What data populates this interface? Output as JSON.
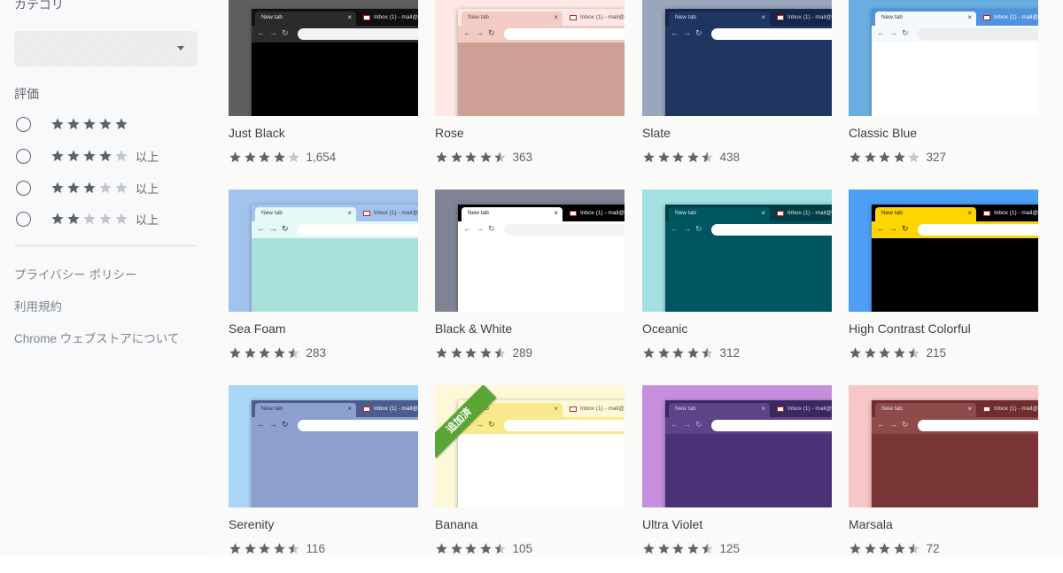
{
  "sidebar": {
    "category_heading": "カテゴリ",
    "category_select": {
      "value": ""
    },
    "rating_heading": "評価",
    "rating_options": [
      {
        "stars": 5,
        "suffix": ""
      },
      {
        "stars": 4,
        "suffix": "以上"
      },
      {
        "stars": 3,
        "suffix": "以上"
      },
      {
        "stars": 2,
        "suffix": "以上"
      }
    ],
    "links": [
      "プライバシー ポリシー",
      "利用規約",
      "Chrome ウェブストアについて"
    ]
  },
  "mock_browser": {
    "new_tab": "New tab",
    "second_tab": "Inbox (1) - mail@"
  },
  "badge_new": "追加済",
  "themes": [
    {
      "name": "Just Black",
      "rating": 4.0,
      "count": "1,654",
      "colors": {
        "bg": "#5f5f5f",
        "tabstrip": "#101010",
        "tab": "#2b2b2b",
        "tabtext": "#e8e8e8",
        "toolbar": "#2b2b2b",
        "omni": "#f1f3f4",
        "icons": "#bdbdbd",
        "ntp": "#000000",
        "tab2text": "#e0e0e0"
      }
    },
    {
      "name": "Rose",
      "rating": 4.5,
      "count": "363",
      "colors": {
        "bg": "#fde8e6",
        "tabstrip": "#fde8e6",
        "tab": "#f3cbc5",
        "tabtext": "#5a4744",
        "toolbar": "#f3cbc5",
        "omni": "#ffffff",
        "icons": "#5a4744",
        "ntp": "#cda096",
        "tab2text": "#5a4744"
      }
    },
    {
      "name": "Slate",
      "rating": 4.5,
      "count": "438",
      "colors": {
        "bg": "#9ba5bc",
        "tabstrip": "#16254a",
        "tab": "#1f3663",
        "tabtext": "#d6dbe6",
        "toolbar": "#1f3663",
        "omni": "#ffffff",
        "icons": "#c5cbd8",
        "ntp": "#1f3663",
        "tab2text": "#d6dbe6"
      }
    },
    {
      "name": "Classic Blue",
      "rating": 4.0,
      "count": "327",
      "colors": {
        "bg": "#6aaee0",
        "tabstrip": "#4f92de",
        "tab": "#f5f8fc",
        "tabtext": "#3c4043",
        "toolbar": "#f5f8fc",
        "omni": "#ebedef",
        "icons": "#5f6368",
        "ntp": "#ffffff",
        "tab2text": "#ffffff"
      }
    },
    {
      "name": "Sea Foam",
      "rating": 4.5,
      "count": "283",
      "colors": {
        "bg": "#a3c3ef",
        "tabstrip": "#a3c3ef",
        "tab": "#e4f8f5",
        "tabtext": "#3c4043",
        "toolbar": "#e4f8f5",
        "omni": "#ffffff",
        "icons": "#3c4043",
        "ntp": "#a8e1da",
        "tab2text": "#3c4043"
      }
    },
    {
      "name": "Black & White",
      "rating": 4.5,
      "count": "289",
      "colors": {
        "bg": "#7f8394",
        "tabstrip": "#000000",
        "tab": "#ffffff",
        "tabtext": "#202124",
        "toolbar": "#ffffff",
        "omni": "#f1f3f4",
        "icons": "#5f6368",
        "ntp": "#ffffff",
        "tab2text": "#ffffff"
      }
    },
    {
      "name": "Oceanic",
      "rating": 4.5,
      "count": "312",
      "colors": {
        "bg": "#a3e1e1",
        "tabstrip": "#003f46",
        "tab": "#005660",
        "tabtext": "#d3eaec",
        "toolbar": "#005660",
        "omni": "#ffffff",
        "icons": "#9ec8cc",
        "ntp": "#005660",
        "tab2text": "#d3eaec"
      }
    },
    {
      "name": "High Contrast Colorful",
      "rating": 4.5,
      "count": "215",
      "colors": {
        "bg": "#4d9ff5",
        "tabstrip": "#000000",
        "tab": "#fdd600",
        "tabtext": "#202124",
        "toolbar": "#fdd600",
        "omni": "#ffffff",
        "icons": "#202124",
        "ntp": "#000000",
        "tab2text": "#ffffff"
      }
    },
    {
      "name": "Serenity",
      "rating": 4.5,
      "count": "116",
      "colors": {
        "bg": "#a9d6f7",
        "tabstrip": "#4b5c8e",
        "tab": "#8c9fcf",
        "tabtext": "#2a3354",
        "toolbar": "#8c9fcf",
        "omni": "#ffffff",
        "icons": "#2a3354",
        "ntp": "#8c9fcf",
        "tab2text": "#ffffff"
      }
    },
    {
      "name": "Banana",
      "rating": 4.5,
      "count": "105",
      "colors": {
        "bg": "#fdf8d8",
        "tabstrip": "#fdf8d8",
        "tab": "#f8ea8a",
        "tabtext": "#5a5a30",
        "toolbar": "#f8ea8a",
        "omni": "#ffffff",
        "icons": "#5a5a30",
        "ntp": "#ffffff",
        "tab2text": "#5a5a30"
      }
    },
    {
      "name": "Ultra Violet",
      "rating": 4.5,
      "count": "125",
      "colors": {
        "bg": "#c58fdd",
        "tabstrip": "#3a2860",
        "tab": "#5d4388",
        "tabtext": "#dcd0ec",
        "toolbar": "#5d4388",
        "omni": "#ffffff",
        "icons": "#b9a5d6",
        "ntp": "#4a3277",
        "tab2text": "#dcd0ec"
      }
    },
    {
      "name": "Marsala",
      "rating": 4.5,
      "count": "72",
      "colors": {
        "bg": "#f7c6c6",
        "tabstrip": "#6f2d30",
        "tab": "#8f4a4c",
        "tabtext": "#f0dcdc",
        "toolbar": "#8f4a4c",
        "omni": "#ffffff",
        "icons": "#e2c0c0",
        "ntp": "#7a3537",
        "tab2text": "#f0dcdc"
      }
    }
  ],
  "colors": {
    "star_filled": "#5f6368",
    "star_empty": "#c4c7ca",
    "sidebar_bg": "#f8f9fa",
    "grid_bg": "#fafaf8",
    "badge_green": "#59a536"
  }
}
